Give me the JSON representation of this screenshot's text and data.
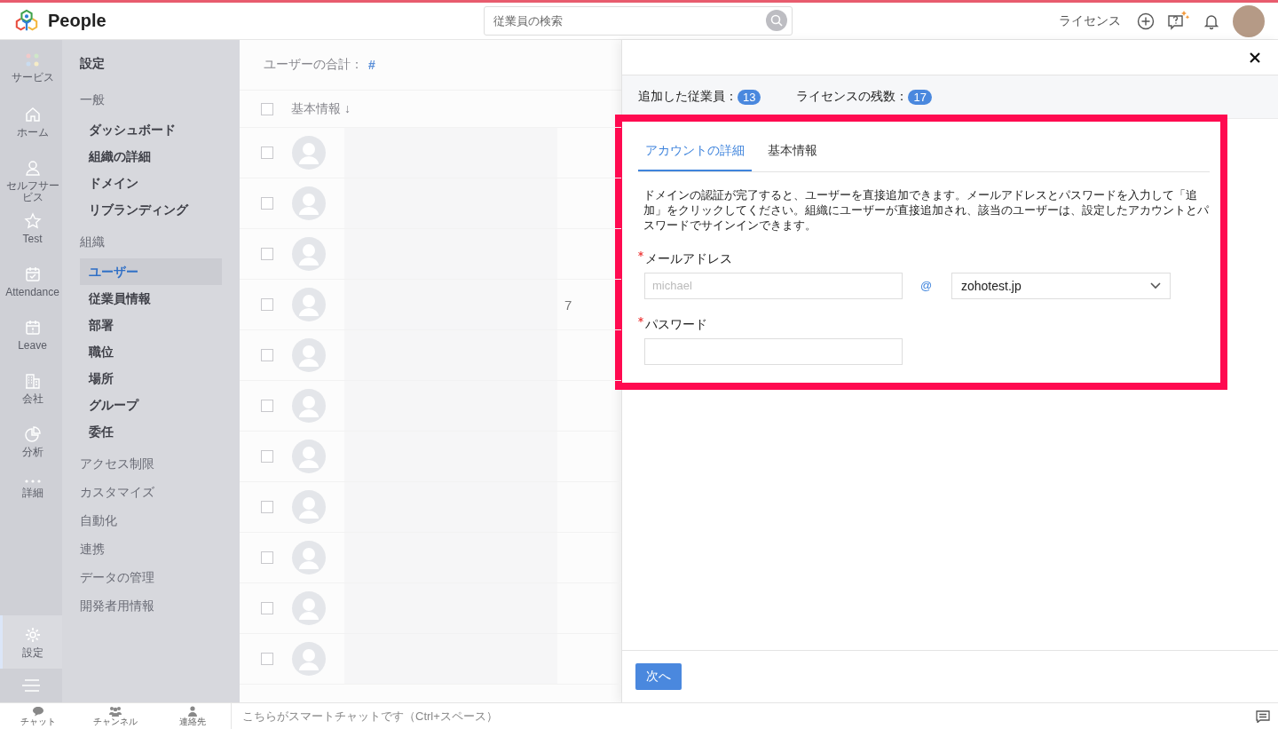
{
  "topbar": {
    "app_name": "People",
    "search": {
      "placeholder": "従業員の検索"
    },
    "license_link": "ライセンス"
  },
  "rail": [
    {
      "label": "サービス",
      "kind": "apps",
      "selected": false
    },
    {
      "label": "ホーム",
      "kind": "home",
      "selected": false
    },
    {
      "label": "セルフサービス",
      "kind": "person",
      "selected": false
    },
    {
      "label": "Test",
      "kind": "star",
      "selected": false
    },
    {
      "label": "Attendance",
      "kind": "attendance",
      "selected": false
    },
    {
      "label": "Leave",
      "kind": "leave",
      "selected": false
    },
    {
      "label": "会社",
      "kind": "building",
      "selected": false
    },
    {
      "label": "分析",
      "kind": "pie",
      "selected": false
    },
    {
      "label": "詳細",
      "kind": "more",
      "selected": false
    },
    {
      "label": "設定",
      "kind": "settings",
      "selected": true
    }
  ],
  "settings_nav": {
    "title": "設定",
    "sections": [
      {
        "label": "一般",
        "children": [
          {
            "label": "ダッシュボード",
            "selected": false
          },
          {
            "label": "組織の詳細",
            "selected": false
          },
          {
            "label": "ドメイン",
            "selected": false
          },
          {
            "label": "リブランディング",
            "selected": false
          }
        ]
      },
      {
        "label": "組織",
        "children": [
          {
            "label": "ユーザー",
            "selected": true
          },
          {
            "label": "従業員情報",
            "selected": false
          },
          {
            "label": "部署",
            "selected": false
          },
          {
            "label": "職位",
            "selected": false
          },
          {
            "label": "場所",
            "selected": false
          },
          {
            "label": "グループ",
            "selected": false
          },
          {
            "label": "委任",
            "selected": false
          }
        ]
      },
      {
        "label": "アクセス制限"
      },
      {
        "label": "カスタマイズ"
      },
      {
        "label": "自動化"
      },
      {
        "label": "連携"
      },
      {
        "label": "データの管理"
      },
      {
        "label": "開発者用情報"
      }
    ]
  },
  "user_list": {
    "total_label": "ユーザーの合計：",
    "total_value": "#",
    "column": "基本情報 ↓",
    "all_checked": false,
    "rows": [
      {
        "kind": "blurred",
        "checked": false
      },
      {
        "kind": "blurred",
        "checked": false
      },
      {
        "kind": "blurred",
        "checked": false
      },
      {
        "kind": "blurred",
        "checked": false,
        "trailing": "7"
      },
      {
        "kind": "blurred",
        "checked": false
      },
      {
        "kind": "blurred",
        "checked": false
      },
      {
        "kind": "blurred",
        "checked": false
      },
      {
        "kind": "blurred",
        "checked": false
      },
      {
        "kind": "blurred",
        "checked": false
      },
      {
        "kind": "blurred",
        "checked": false
      },
      {
        "kind": "blurred",
        "checked": false
      }
    ]
  },
  "panel": {
    "added_label": "追加した従業員：",
    "added_count": "13",
    "remaining_label": "ライセンスの残数：",
    "remaining_count": "17",
    "highlighted": true,
    "tabs": [
      {
        "label": "アカウントの詳細",
        "selected": true
      },
      {
        "label": "基本情報",
        "selected": false
      }
    ],
    "description": "ドメインの認証が完了すると、ユーザーを直接追加できます。メールアドレスとパスワードを入力して「追加」をクリックしてください。組織にユーザーが直接追加され、該当のユーザーは、設定したアカウントとパスワードでサインインできます。",
    "email": {
      "label": "メールアドレス",
      "required": true,
      "placeholder": "michael",
      "separator": "@",
      "domain": "zohotest.jp"
    },
    "password": {
      "label": "パスワード",
      "required": true
    },
    "next_button": "次へ"
  },
  "bottom_bar": {
    "items": [
      {
        "label": "チャット",
        "kind": "chat"
      },
      {
        "label": "チャンネル",
        "kind": "channel"
      },
      {
        "label": "連絡先",
        "kind": "contact"
      }
    ],
    "chat_placeholder": "こちらがスマートチャットです（Ctrl+スペース）"
  }
}
